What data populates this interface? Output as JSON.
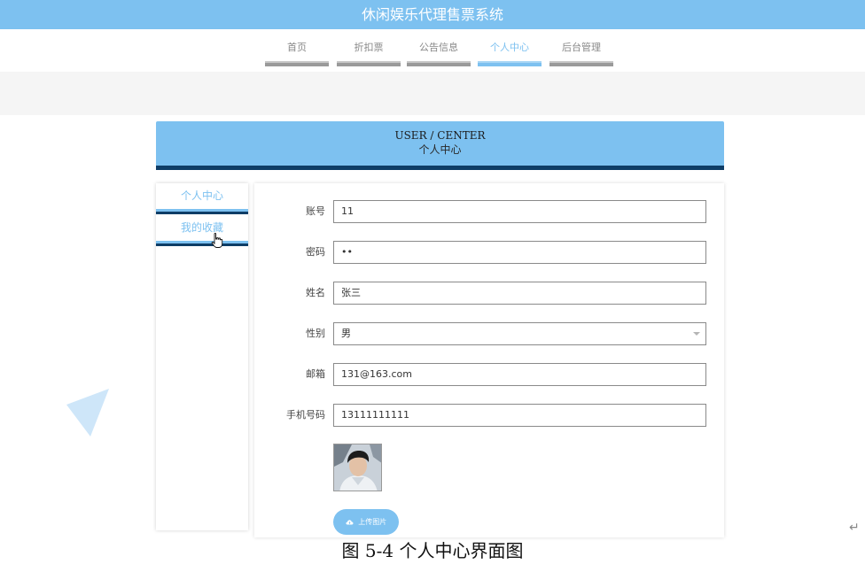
{
  "app": {
    "title": "休闲娱乐代理售票系统"
  },
  "nav": {
    "items": [
      {
        "label": "首页"
      },
      {
        "label": "折扣票"
      },
      {
        "label": "公告信息"
      },
      {
        "label": "个人中心"
      },
      {
        "label": "后台管理"
      }
    ],
    "active": "个人中心"
  },
  "header": {
    "en": "USER / CENTER",
    "cn": "个人中心"
  },
  "sidebar": {
    "items": [
      {
        "label": "个人中心"
      },
      {
        "label": "我的收藏"
      }
    ]
  },
  "form": {
    "account": {
      "label": "账号",
      "value": "11"
    },
    "password": {
      "label": "密码",
      "value": "••"
    },
    "name": {
      "label": "姓名",
      "value": "张三"
    },
    "gender": {
      "label": "性别",
      "value": "男"
    },
    "email": {
      "label": "邮箱",
      "value": "131@163.com"
    },
    "phone": {
      "label": "手机号码",
      "value": "13111111111"
    },
    "upload_label": "上传图片"
  },
  "caption": "图 5-4 个人中心界面图",
  "icons": {
    "cursor": "hand-pointer-icon",
    "upload": "cloud-upload-icon",
    "select": "chevron-down-icon"
  },
  "colors": {
    "accent": "#7dc1f0",
    "dark_stripe": "#0e3d66",
    "nav_bar": "#9a9a9a"
  }
}
